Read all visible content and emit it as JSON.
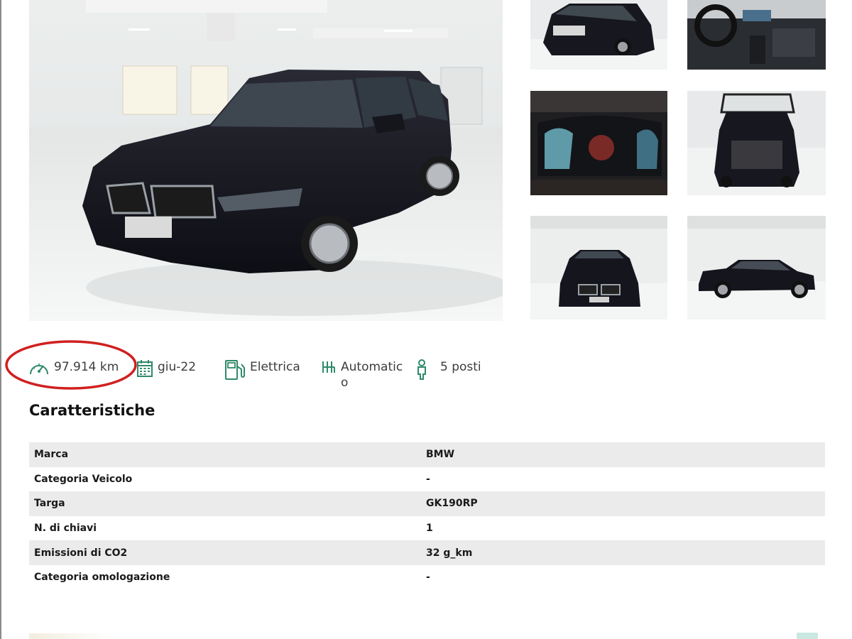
{
  "gallery": {
    "main_image": "bmw-3-series-touring-front-three-quarter",
    "thumbnails": [
      "rear-three-quarter-view",
      "dashboard-interior",
      "digital-instrument-cluster",
      "open-trunk-rear-view",
      "front-view",
      "side-profile-view"
    ]
  },
  "specs": {
    "mileage": "97.914 km",
    "registration_date": "giu-22",
    "fuel": "Elettrica",
    "transmission": "Automatico",
    "seats": "5 posti"
  },
  "icons": {
    "mileage": "speedometer-icon",
    "registration_date": "calendar-icon",
    "fuel": "fuel-pump-icon",
    "transmission": "gearbox-icon",
    "seats": "seat-icon"
  },
  "colors": {
    "accent": "#2e8a68",
    "annotation": "#d0201f",
    "row_shade": "#ebebeb"
  },
  "features": {
    "title": "Caratteristiche",
    "rows": [
      {
        "label": "Marca",
        "value": "BMW"
      },
      {
        "label": "Categoria Veicolo",
        "value": "-"
      },
      {
        "label": "Targa",
        "value": "GK190RP"
      },
      {
        "label": "N. di chiavi",
        "value": "1"
      },
      {
        "label": "Emissioni di CO2",
        "value": "32 g_km"
      },
      {
        "label": "Categoria omologazione",
        "value": "-"
      }
    ]
  }
}
